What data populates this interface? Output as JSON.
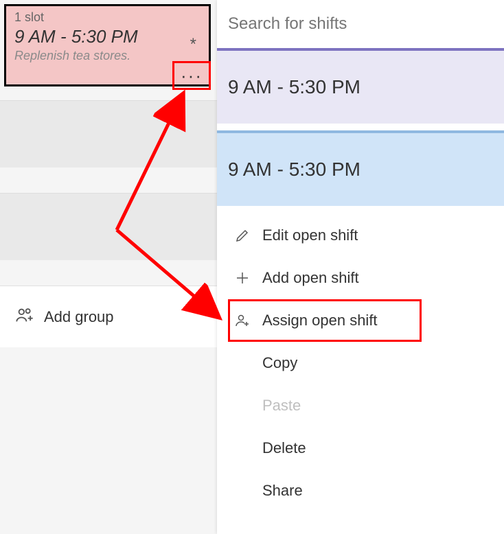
{
  "shift_card": {
    "slot_label": "1 slot",
    "time": "9 AM - 5:30 PM",
    "note": "Replenish tea stores.",
    "asterisk": "*",
    "more_dots": "···"
  },
  "add_group": {
    "label": "Add group"
  },
  "search": {
    "placeholder": "Search for shifts"
  },
  "shift_results": [
    {
      "time": "9 AM - 5:30 PM"
    },
    {
      "time": "9 AM - 5:30 PM"
    }
  ],
  "menu": {
    "edit": "Edit open shift",
    "add": "Add open shift",
    "assign": "Assign open shift",
    "copy": "Copy",
    "paste": "Paste",
    "delete": "Delete",
    "share": "Share"
  }
}
